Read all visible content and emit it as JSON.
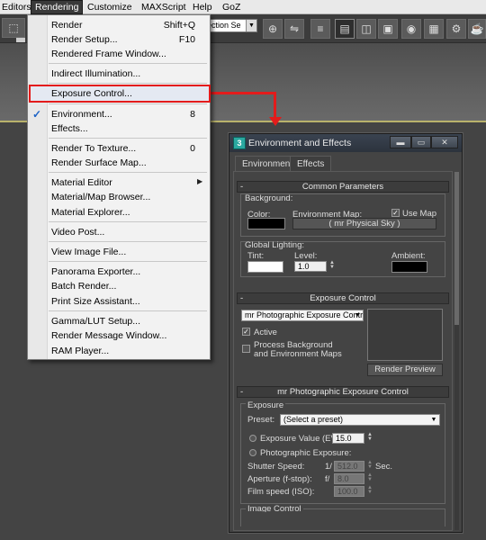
{
  "menubar": {
    "items": [
      "Editors",
      "Rendering",
      "Customize",
      "MAXScript",
      "Help",
      "GoZ"
    ]
  },
  "toolbar": {
    "selection_set": "lection Se",
    "icon_names": [
      "select-region-icon",
      "select-tool-icon",
      "rotate-icon",
      "scale-icon",
      "named-selection-icon",
      "mirror-icon",
      "align-icon",
      "layer-icon",
      "graphite-icon",
      "curve-editor-icon",
      "schematic-icon",
      "material-editor-icon",
      "render-setup-icon",
      "render-frame-icon",
      "render-icon"
    ]
  },
  "menu": {
    "items": [
      {
        "label": "Render",
        "shortcut": "Shift+Q"
      },
      {
        "label": "Render Setup...",
        "shortcut": "F10"
      },
      {
        "label": "Rendered Frame Window...",
        "shortcut": ""
      },
      {
        "label": "Indirect Illumination...",
        "shortcut": ""
      },
      {
        "label": "Exposure Control...",
        "shortcut": ""
      },
      {
        "label": "Environment...",
        "shortcut": "8"
      },
      {
        "label": "Effects...",
        "shortcut": ""
      },
      {
        "label": "Render To Texture...",
        "shortcut": "0"
      },
      {
        "label": "Render Surface Map...",
        "shortcut": ""
      },
      {
        "label": "Material Editor",
        "shortcut": ""
      },
      {
        "label": "Material/Map Browser...",
        "shortcut": ""
      },
      {
        "label": "Material Explorer...",
        "shortcut": ""
      },
      {
        "label": "Video Post...",
        "shortcut": ""
      },
      {
        "label": "View Image File...",
        "shortcut": ""
      },
      {
        "label": "Panorama Exporter...",
        "shortcut": ""
      },
      {
        "label": "Batch Render...",
        "shortcut": ""
      },
      {
        "label": "Print Size Assistant...",
        "shortcut": ""
      },
      {
        "label": "Gamma/LUT Setup...",
        "shortcut": ""
      },
      {
        "label": "Render Message Window...",
        "shortcut": ""
      },
      {
        "label": "RAM Player...",
        "shortcut": ""
      }
    ]
  },
  "dialog": {
    "title": "Environment and Effects",
    "buttons": {
      "minimize": "▬",
      "maximize": "▭",
      "close": "✕"
    },
    "tabs": [
      "Environment",
      "Effects"
    ],
    "common": {
      "header": "Common Parameters",
      "background_group": "Background:",
      "color_label": "Color:",
      "envmap_label": "Environment Map:",
      "use_map_label": "Use Map",
      "use_map_checked": true,
      "envmap_button": "( mr Physical Sky )",
      "global_lighting_group": "Global Lighting:",
      "tint_label": "Tint:",
      "level_label": "Level:",
      "level_value": "1.0",
      "ambient_label": "Ambient:",
      "colors": {
        "background": "#000000",
        "tint": "#ffffff",
        "ambient": "#000000"
      }
    },
    "exposure": {
      "header": "Exposure Control",
      "type_value": "mr Photographic Exposure Contro",
      "active_label": "Active",
      "active_checked": true,
      "process_bg_label": "Process Background",
      "process_bg_label2": "and Environment Maps",
      "render_preview_label": "Render Preview"
    },
    "mr_photo": {
      "header": "mr Photographic Exposure Control",
      "exposure_group": "Exposure",
      "preset_label": "Preset:",
      "preset_value": "(Select a preset)",
      "ev_label": "Exposure Value (EV):",
      "ev_value": "15.0",
      "photo_label": "Photographic Exposure:",
      "shutter_label": "Shutter Speed:",
      "shutter_prefix": "1/",
      "shutter_value": "512.0",
      "shutter_unit": "Sec.",
      "aperture_label": "Aperture (f-stop):",
      "aperture_prefix": "f/",
      "aperture_value": "8.0",
      "film_label": "Film speed (ISO):",
      "film_value": "100.0",
      "image_control_label": "Image Control"
    }
  },
  "colors": {
    "highlight_box": "#e31b1b",
    "check": "#1d63c6"
  }
}
